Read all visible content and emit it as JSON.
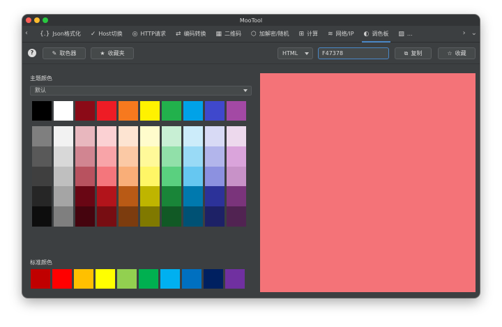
{
  "window": {
    "title": "MooTool"
  },
  "traffic_colors": [
    "#ff5f57",
    "#febc2e",
    "#28c840"
  ],
  "tabs": [
    {
      "label": "Json格式化",
      "icon": "{.}",
      "active": false
    },
    {
      "label": "Host切换",
      "icon": "✓",
      "active": false
    },
    {
      "label": "HTTP请求",
      "icon": "◎",
      "active": false
    },
    {
      "label": "编码转换",
      "icon": "⇄",
      "active": false
    },
    {
      "label": "二维码",
      "icon": "▦",
      "active": false
    },
    {
      "label": "加解密/随机",
      "icon": "⬡",
      "active": false
    },
    {
      "label": "计算",
      "icon": "⊞",
      "active": false
    },
    {
      "label": "网络/IP",
      "icon": "≋",
      "active": false
    },
    {
      "label": "调色板",
      "icon": "◐",
      "active": true
    },
    {
      "label": "...",
      "icon": "▨",
      "active": false
    }
  ],
  "toolbar": {
    "help_label": "?",
    "picker_label": "取色器",
    "favorites_label": "收藏夹",
    "format_value": "HTML",
    "hex_value": "F47378",
    "copy_label": "复制",
    "collect_label": "收藏"
  },
  "theme": {
    "label": "主题颜色",
    "selected": "默认"
  },
  "standard": {
    "label": "标准颜色"
  },
  "top_swatches": [
    "#000000",
    "#ffffff",
    "#8b0a17",
    "#ee1c25",
    "#f7791e",
    "#fff200",
    "#22b14c",
    "#00a2e8",
    "#3f48cc",
    "#a349a4"
  ],
  "shade_grid": [
    [
      "#7f7f7f",
      "#595959",
      "#3f3f3f",
      "#262626",
      "#0d0d0d"
    ],
    [
      "#f2f2f2",
      "#d8d8d8",
      "#bfbfbf",
      "#a5a5a5",
      "#7f7f7f"
    ],
    [
      "#e8b7be",
      "#d18591",
      "#b8525f",
      "#690614",
      "#45040e"
    ],
    [
      "#fbd1d3",
      "#f8a4a8",
      "#f4767c",
      "#b2141b",
      "#770d12"
    ],
    [
      "#fde4d2",
      "#fbc9a5",
      "#f9ae78",
      "#b95a15",
      "#7c3c0e"
    ],
    [
      "#fffccc",
      "#fff999",
      "#fff666",
      "#bfb500",
      "#807900"
    ],
    [
      "#c8efd4",
      "#91e0a9",
      "#5ad07f",
      "#198538",
      "#115925"
    ],
    [
      "#ccecfa",
      "#99daf6",
      "#66c7f1",
      "#0079ae",
      "#005174"
    ],
    [
      "#d8daf5",
      "#b2b5eb",
      "#8c91e0",
      "#2c3299",
      "#1d2166"
    ],
    [
      "#edd9ed",
      "#daa4db",
      "#c892c8",
      "#7a347b",
      "#512352"
    ]
  ],
  "standard_swatches": [
    "#c00000",
    "#ff0000",
    "#ffc000",
    "#ffff00",
    "#92d050",
    "#00b050",
    "#00b0f0",
    "#0070c0",
    "#002060",
    "#7030a0"
  ],
  "preview_color": "#f47378"
}
